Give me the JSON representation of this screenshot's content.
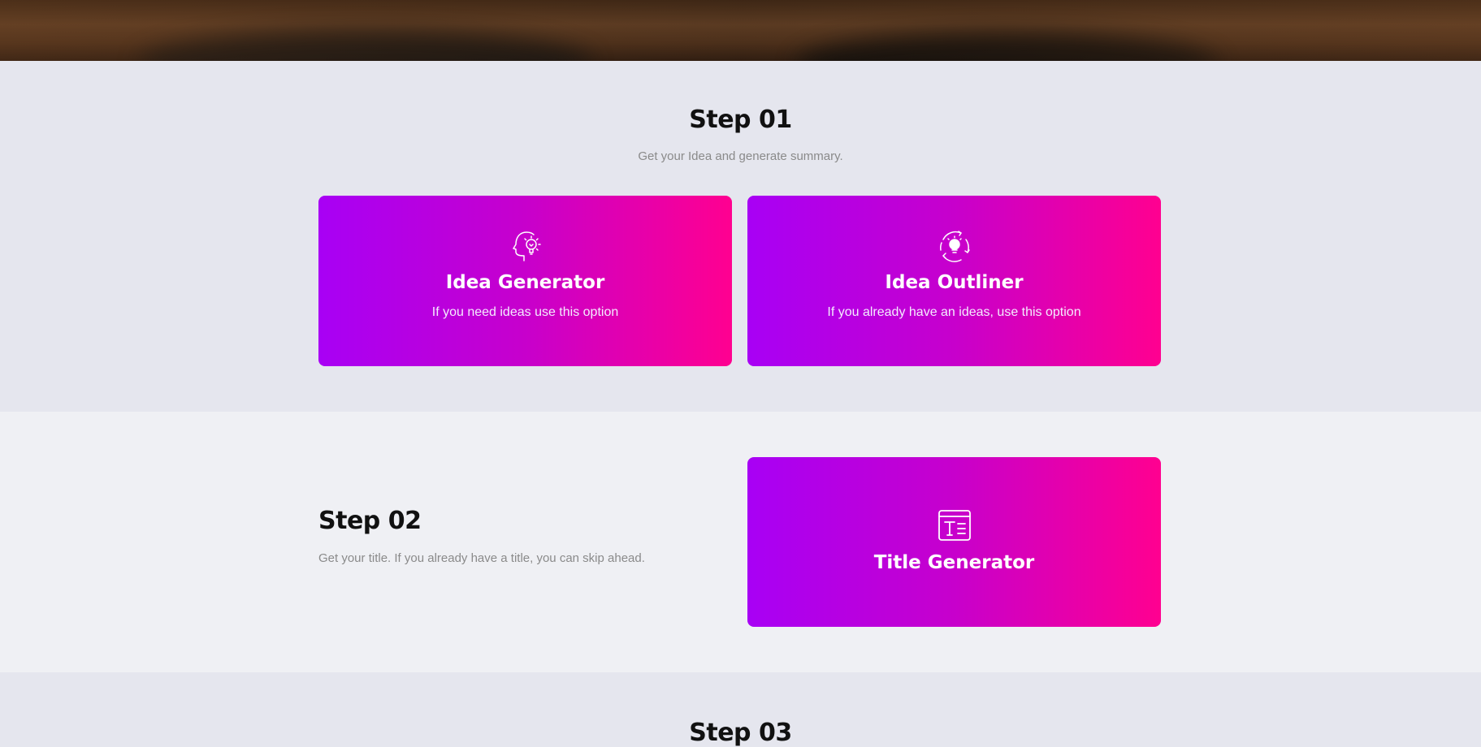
{
  "step1": {
    "title": "Step 01",
    "subtitle": "Get your Idea and generate summary.",
    "cards": [
      {
        "title": "Idea Generator",
        "description": "If you need ideas use this option",
        "icon": "head-lightbulb-icon"
      },
      {
        "title": "Idea Outliner",
        "description": "If you already have an ideas, use this option",
        "icon": "lightbulb-cycle-icon"
      }
    ]
  },
  "step2": {
    "title": "Step 02",
    "subtitle": "Get your title. If you already have a title, you can skip ahead.",
    "card": {
      "title": "Title Generator",
      "icon": "title-document-icon"
    }
  },
  "step3": {
    "title": "Step 03"
  },
  "colors": {
    "gradient_start": "#a800f5",
    "gradient_end": "#ff0090",
    "section_bg_a": "#e5e6ee",
    "section_bg_b": "#eff0f4"
  }
}
